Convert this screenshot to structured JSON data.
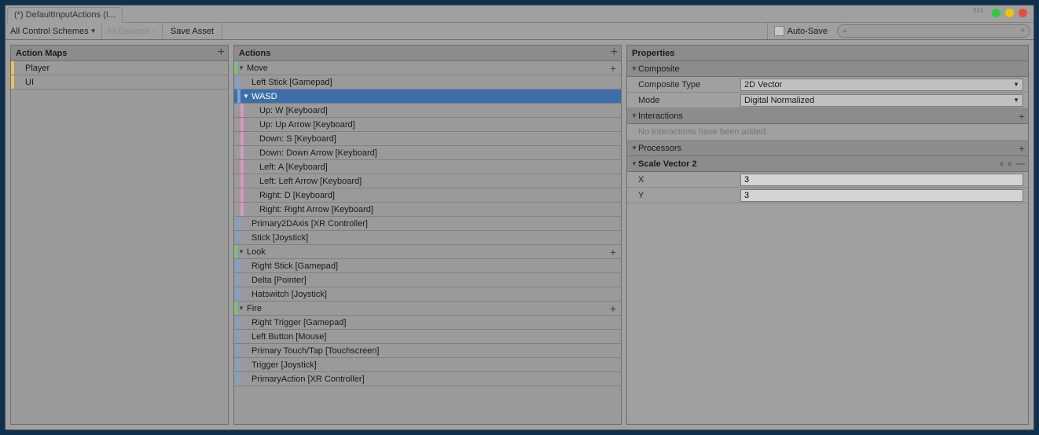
{
  "tab_title": "(*) DefaultInputActions (I...",
  "toolbar": {
    "schemes": "All Control Schemes",
    "devices": "All Devices",
    "save": "Save Asset",
    "auto_save": "Auto-Save"
  },
  "panels": {
    "maps_title": "Action Maps",
    "actions_title": "Actions",
    "props_title": "Properties"
  },
  "action_maps": [
    "Player",
    "UI"
  ],
  "actions": {
    "move": {
      "label": "Move",
      "bindings": {
        "leftstick": "Left Stick [Gamepad]",
        "wasd": "WASD",
        "wasd_children": [
          "Up: W [Keyboard]",
          "Up: Up Arrow [Keyboard]",
          "Down: S [Keyboard]",
          "Down: Down Arrow [Keyboard]",
          "Left: A [Keyboard]",
          "Left: Left Arrow [Keyboard]",
          "Right: D [Keyboard]",
          "Right: Right Arrow [Keyboard]"
        ],
        "primary2d": "Primary2DAxis [XR Controller]",
        "stick": "Stick [Joystick]"
      }
    },
    "look": {
      "label": "Look",
      "bindings": [
        "Right Stick [Gamepad]",
        "Delta [Pointer]",
        "Hatswitch [Joystick]"
      ]
    },
    "fire": {
      "label": "Fire",
      "bindings": [
        "Right Trigger [Gamepad]",
        "Left Button [Mouse]",
        "Primary Touch/Tap [Touchscreen]",
        "Trigger [Joystick]",
        "PrimaryAction [XR Controller]"
      ]
    }
  },
  "properties": {
    "composite_section": "Composite",
    "composite_type_label": "Composite Type",
    "composite_type_value": "2D Vector",
    "mode_label": "Mode",
    "mode_value": "Digital Normalized",
    "interactions_section": "Interactions",
    "interactions_msg": "No Interactions have been added.",
    "processors_section": "Processors",
    "scale_vector_section": "Scale Vector 2",
    "x_label": "X",
    "x_value": "3",
    "y_label": "Y",
    "y_value": "3"
  }
}
